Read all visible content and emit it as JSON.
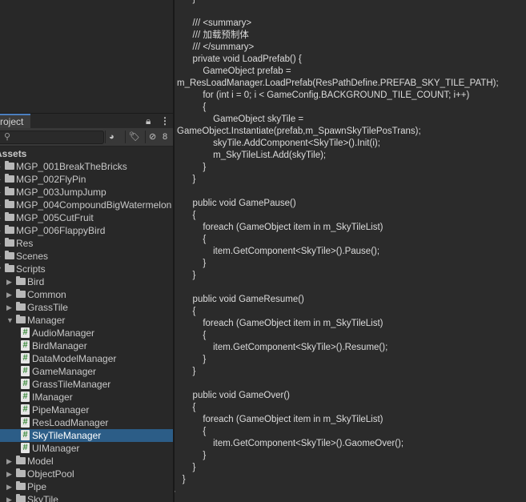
{
  "project": {
    "tab_label": "Project",
    "lock_icon": "lock-icon",
    "menu_icon": "kebab-menu-icon",
    "search_placeholder": "",
    "hidden_count": "8"
  },
  "tree": [
    {
      "label": "Assets",
      "type": "root"
    },
    {
      "label": "MGP_001BreakTheBricks",
      "type": "folder"
    },
    {
      "label": "MGP_002FlyPin",
      "type": "folder"
    },
    {
      "label": "MGP_003JumpJump",
      "type": "folder"
    },
    {
      "label": "MGP_004CompoundBigWatermelon",
      "type": "folder"
    },
    {
      "label": "MGP_005CutFruit",
      "type": "folder"
    },
    {
      "label": "MGP_006FlappyBird",
      "type": "folder"
    },
    {
      "label": "Res",
      "type": "folder"
    },
    {
      "label": "Scenes",
      "type": "folder"
    },
    {
      "label": "Scripts",
      "type": "folder"
    },
    {
      "label": "Bird",
      "type": "folder"
    },
    {
      "label": "Common",
      "type": "folder"
    },
    {
      "label": "GrassTile",
      "type": "folder"
    },
    {
      "label": "Manager",
      "type": "folder"
    },
    {
      "label": "AudioManager",
      "type": "script"
    },
    {
      "label": "BirdManager",
      "type": "script"
    },
    {
      "label": "DataModelManager",
      "type": "script"
    },
    {
      "label": "GameManager",
      "type": "script"
    },
    {
      "label": "GrassTileManager",
      "type": "script"
    },
    {
      "label": "IManager",
      "type": "script"
    },
    {
      "label": "PipeManager",
      "type": "script"
    },
    {
      "label": "ResLoadManager",
      "type": "script"
    },
    {
      "label": "SkyTileManager",
      "type": "script",
      "selected": true
    },
    {
      "label": "UIManager",
      "type": "script"
    },
    {
      "label": "Model",
      "type": "folder"
    },
    {
      "label": "ObjectPool",
      "type": "folder"
    },
    {
      "label": "Pipe",
      "type": "folder"
    },
    {
      "label": "SkyTile",
      "type": "folder"
    }
  ],
  "code_lines": [
    "        }",
    "",
    "        /// <summary>",
    "        /// 加载预制体",
    "        /// </summary>",
    "        private void LoadPrefab() {",
    "            GameObject prefab =",
    "m_ResLoadManager.LoadPrefab(ResPathDefine.PREFAB_SKY_TILE_PATH);",
    "            for (int i = 0; i < GameConfig.BACKGROUND_TILE_COUNT; i++)",
    "            {",
    "                GameObject skyTile =",
    "GameObject.Instantiate(prefab,m_SpawnSkyTilePosTrans);",
    "                skyTile.AddComponent<SkyTile>().Init(i);",
    "                m_SkyTileList.Add(skyTile);",
    "            }",
    "        }",
    "",
    "        public void GamePause()",
    "        {",
    "            foreach (GameObject item in m_SkyTileList)",
    "            {",
    "                item.GetComponent<SkyTile>().Pause();",
    "            }",
    "        }",
    "",
    "        public void GameResume()",
    "        {",
    "            foreach (GameObject item in m_SkyTileList)",
    "            {",
    "                item.GetComponent<SkyTile>().Resume();",
    "            }",
    "        }",
    "",
    "        public void GameOver()",
    "        {",
    "            foreach (GameObject item in m_SkyTileList)",
    "            {",
    "                item.GetComponent<SkyTile>().GaomeOver();",
    "            }",
    "        }",
    "    }",
    "}"
  ],
  "colors": {
    "selection": "#2c5d87",
    "tab_accent": "#4c7fbf",
    "code_bg": "#2b2b2b",
    "panel_bg": "#282828"
  }
}
